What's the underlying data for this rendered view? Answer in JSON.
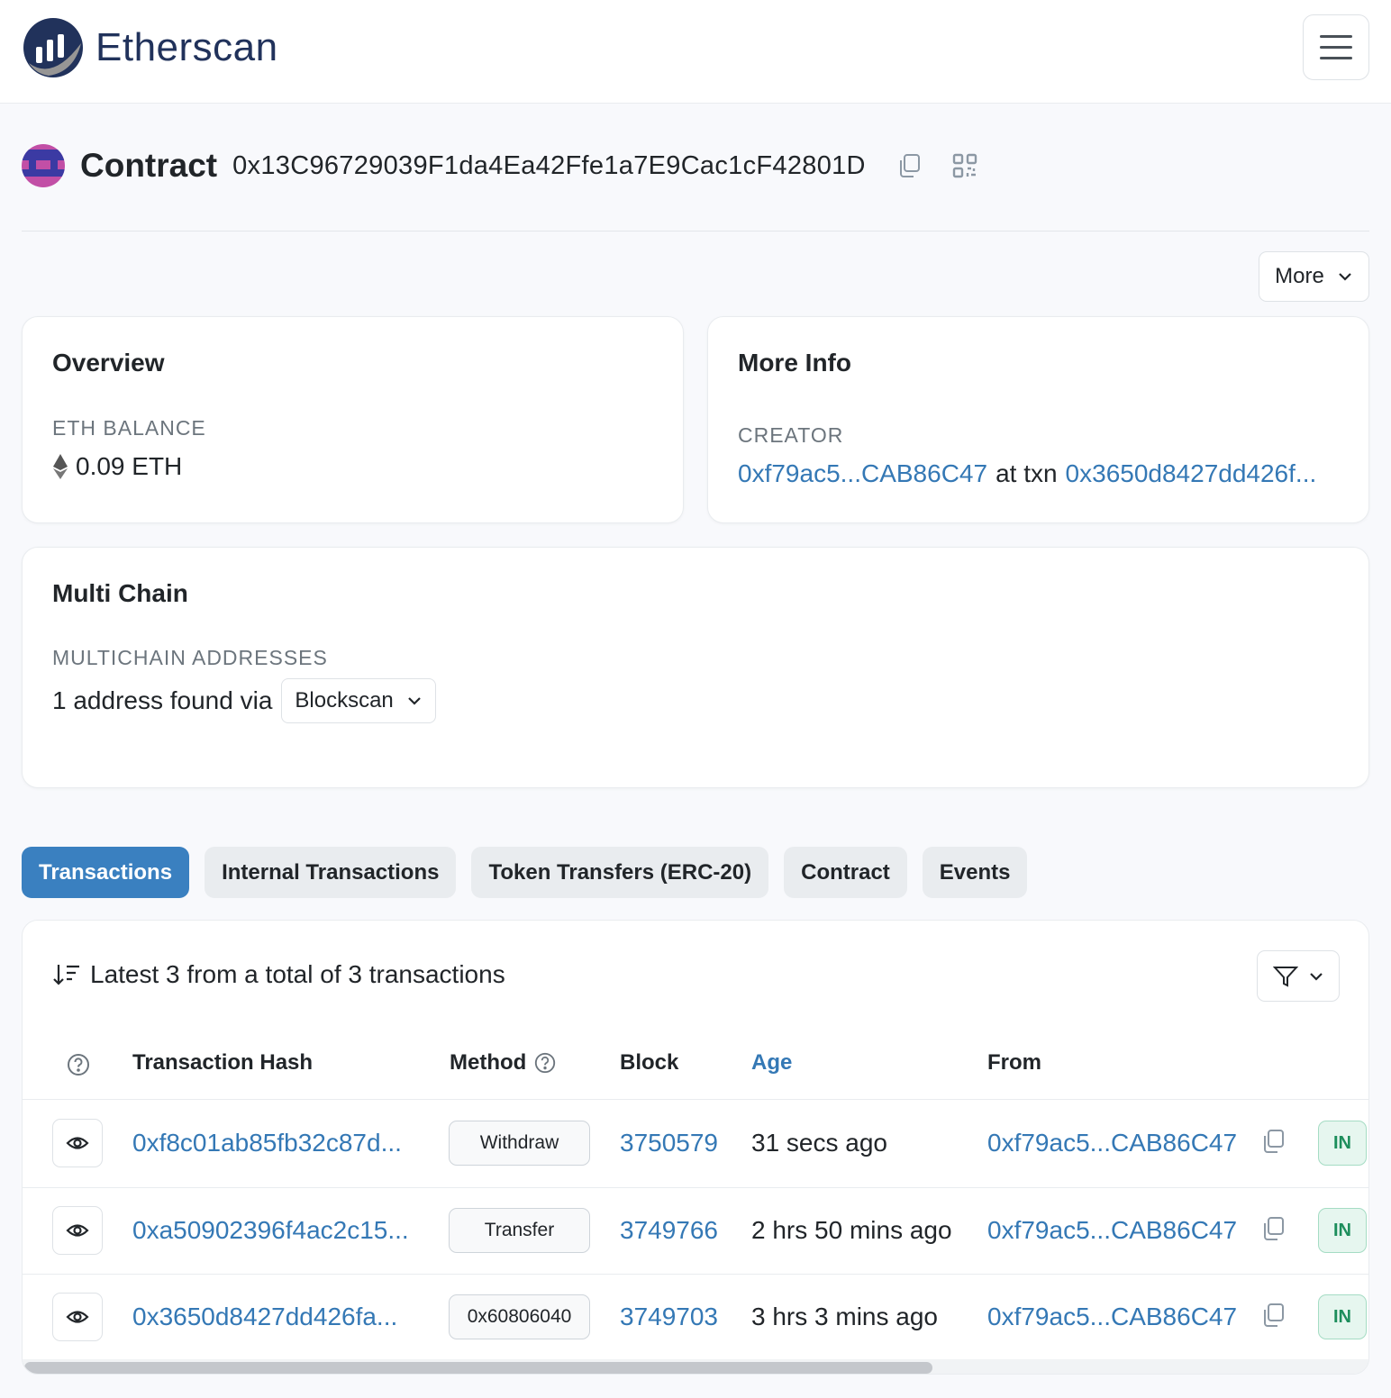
{
  "brand": {
    "name": "Etherscan"
  },
  "contract": {
    "label": "Contract",
    "address": "0x13C96729039F1da4Ea42Ffe1a7E9Cac1cF42801D"
  },
  "more_button": {
    "label": "More"
  },
  "overview": {
    "title": "Overview",
    "balance_label": "ETH BALANCE",
    "balance_value": "0.09 ETH"
  },
  "more_info": {
    "title": "More Info",
    "creator_label": "CREATOR",
    "creator_address": "0xf79ac5...CAB86C47",
    "at_txn": "at txn",
    "creator_txn": "0x3650d8427dd426f..."
  },
  "multichain": {
    "title": "Multi Chain",
    "label": "MULTICHAIN ADDRESSES",
    "found_text": "1 address found via",
    "provider": "Blockscan"
  },
  "tabs": [
    {
      "label": "Transactions",
      "active": true
    },
    {
      "label": "Internal Transactions",
      "active": false
    },
    {
      "label": "Token Transfers (ERC-20)",
      "active": false
    },
    {
      "label": "Contract",
      "active": false
    },
    {
      "label": "Events",
      "active": false
    }
  ],
  "transactions": {
    "summary": "Latest 3 from a total of 3 transactions",
    "columns": {
      "hash": "Transaction Hash",
      "method": "Method",
      "block": "Block",
      "age": "Age",
      "from": "From"
    },
    "rows": [
      {
        "hash": "0xf8c01ab85fb32c87d...",
        "method": "Withdraw",
        "block": "3750579",
        "age": "31 secs ago",
        "from": "0xf79ac5...CAB86C47",
        "direction": "IN"
      },
      {
        "hash": "0xa50902396f4ac2c15...",
        "method": "Transfer",
        "block": "3749766",
        "age": "2 hrs 50 mins ago",
        "from": "0xf79ac5...CAB86C47",
        "direction": "IN"
      },
      {
        "hash": "0x3650d8427dd426fa...",
        "method": "0x60806040",
        "block": "3749703",
        "age": "3 hrs 3 mins ago",
        "from": "0xf79ac5...CAB86C47",
        "direction": "IN"
      }
    ]
  },
  "colors": {
    "accent": "#3a80c0",
    "link": "#3478b5",
    "in_badge": "#1d8e5c"
  },
  "icons": [
    "etherscan-logo-icon",
    "hamburger-menu-icon",
    "copy-icon",
    "qr-code-icon",
    "chevron-down-icon",
    "ethereum-icon",
    "sort-icon",
    "filter-icon",
    "help-circle-icon",
    "eye-icon"
  ]
}
